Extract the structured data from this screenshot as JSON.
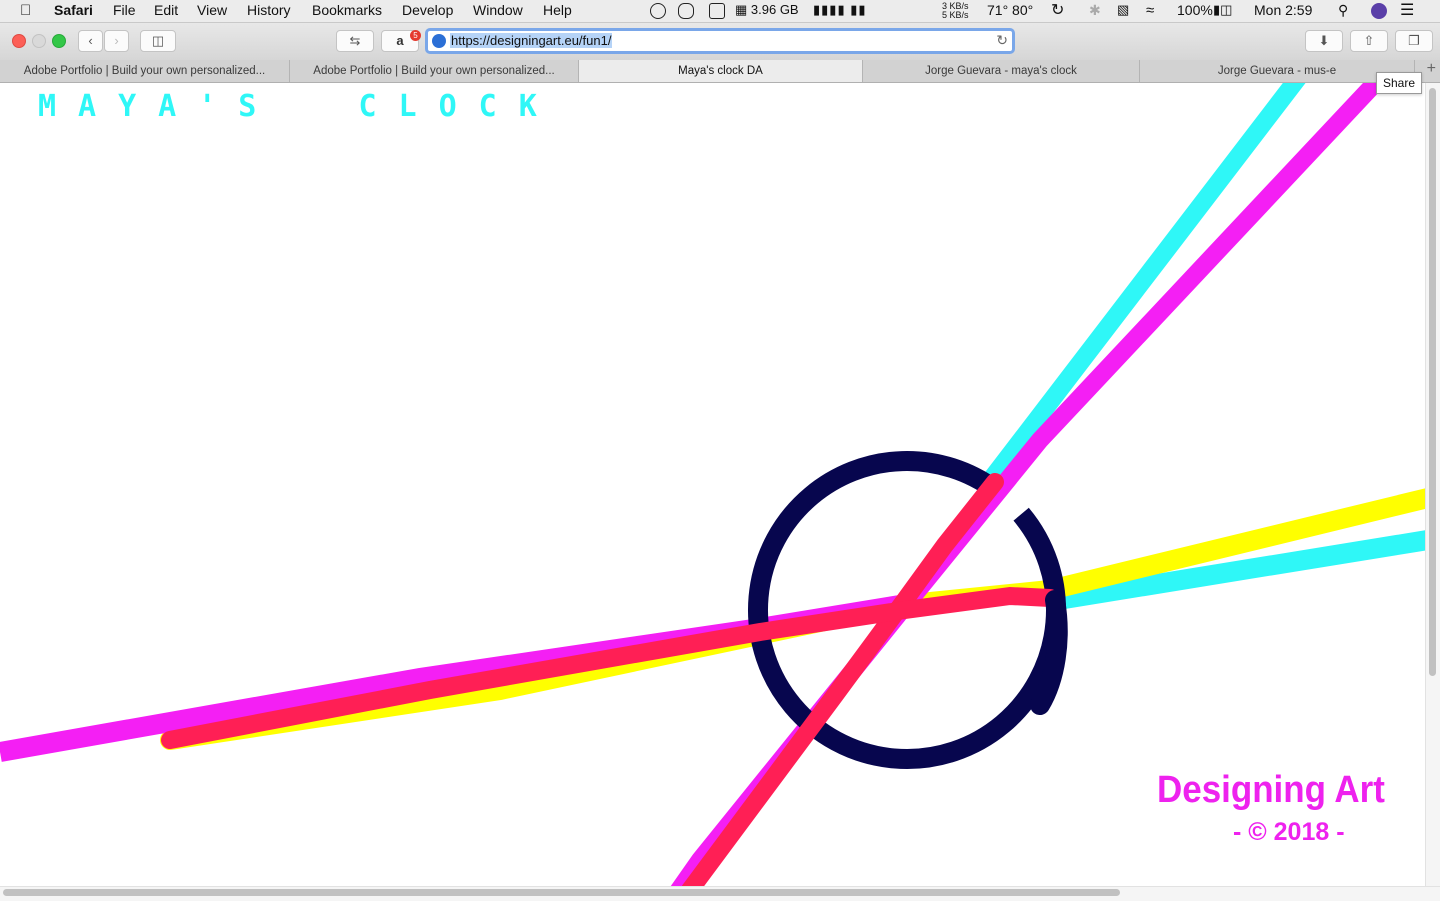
{
  "menubar": {
    "app": "Safari",
    "items": [
      "File",
      "Edit",
      "View",
      "History",
      "Bookmarks",
      "Develop",
      "Window",
      "Help"
    ],
    "memory": "3.96 GB",
    "net_up": "3 KB/s",
    "net_down": "5 KB/s",
    "temps": "71° 80°",
    "battery": "100%",
    "clock": "Mon 2:59"
  },
  "toolbar": {
    "url": "https://designingart.eu/fun1/",
    "extension_badge": "5"
  },
  "tabs": [
    {
      "label": "Adobe Portfolio | Build your own personalized..."
    },
    {
      "label": "Adobe Portfolio | Build your own personalized..."
    },
    {
      "label": "Maya's clock DA",
      "active": true
    },
    {
      "label": "Jorge Guevara - maya's clock"
    },
    {
      "label": "Jorge Guevara - mus-e"
    }
  ],
  "tooltip": "Share",
  "page": {
    "title": "MAYA'S  CLOCK",
    "brand": "Designing Art",
    "copyright": "- © 2018 -"
  },
  "colors": {
    "cyan": "#2ff7f7",
    "magenta": "#f41ff4",
    "yellow": "#ffff00",
    "red": "#ff1f55",
    "navy": "#07064e"
  }
}
